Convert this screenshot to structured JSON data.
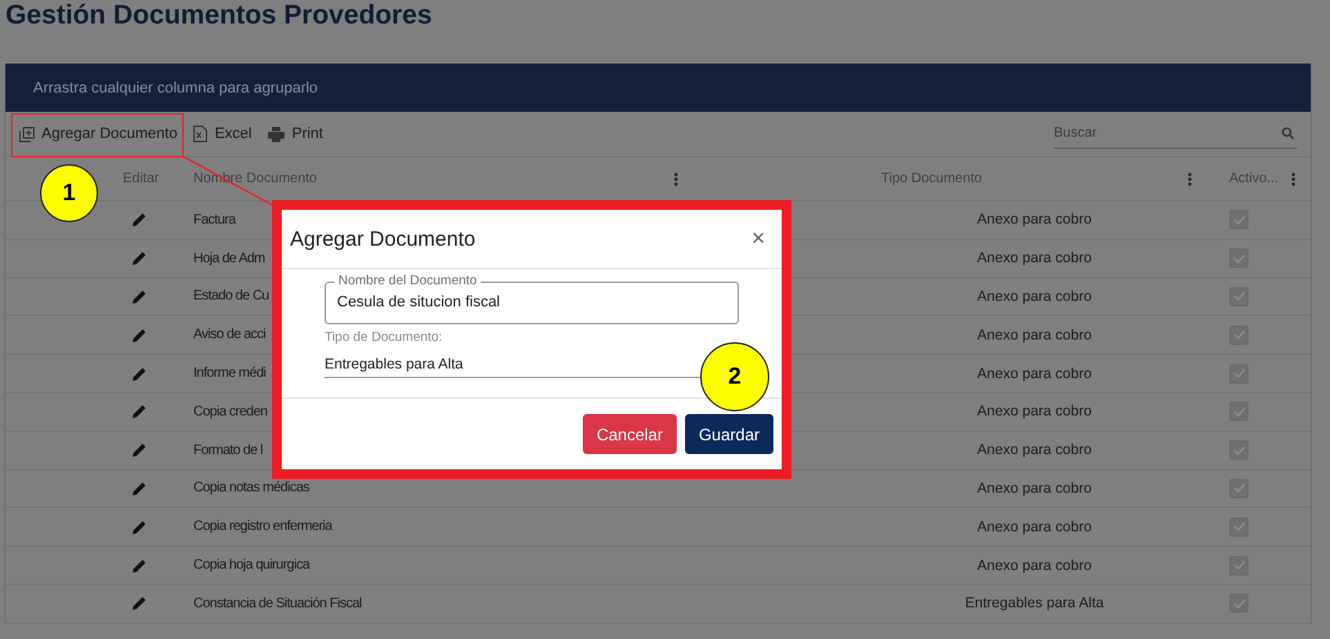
{
  "page_title": "Gestión Documentos Provedores",
  "group_bar": {
    "text": "Arrastra cualquier columna para agruparlo"
  },
  "toolbar": [
    {
      "kind": "add",
      "label": "Agregar Documento"
    },
    {
      "kind": "excel",
      "label": "Excel"
    },
    {
      "kind": "print",
      "label": "Print"
    }
  ],
  "search": {
    "placeholder": "Buscar"
  },
  "columns": [
    "Editar",
    "Nombre Documento",
    "Tipo Documento",
    "Activo..."
  ],
  "rows": [
    {
      "name": "Factura",
      "type": "Anexo para cobro",
      "active": true
    },
    {
      "name": "Hoja de Adm",
      "type": "Anexo para cobro",
      "active": true
    },
    {
      "name": "Estado de Cu",
      "type": "Anexo para cobro",
      "active": true
    },
    {
      "name": "Aviso de acci",
      "type": "Anexo para cobro",
      "active": true
    },
    {
      "name": "Informe médi",
      "type": "Anexo para cobro",
      "active": true
    },
    {
      "name": "Copia creden",
      "type": "Anexo para cobro",
      "active": true
    },
    {
      "name": "Formato de l",
      "type": "Anexo para cobro",
      "active": true
    },
    {
      "name": "Copia notas médicas",
      "type": "Anexo para cobro",
      "active": true
    },
    {
      "name": "Copia registro enfermeria",
      "type": "Anexo para cobro",
      "active": true
    },
    {
      "name": "Copia hoja quirurgica",
      "type": "Anexo para cobro",
      "active": true
    },
    {
      "name": "Constancia de Situación Fiscal",
      "type": "Entregables para Alta",
      "active": true
    }
  ],
  "modal": {
    "title": "Agregar Documento",
    "close": "×",
    "name_field": {
      "label": "Nombre del Documento",
      "value": "Cesula de situcion fiscal"
    },
    "type_field": {
      "label": "Tipo de Documento:",
      "value": "Entregables para Alta"
    },
    "buttons": [
      {
        "kind": "cancel",
        "label": "Cancelar"
      },
      {
        "kind": "save",
        "label": "Guardar"
      }
    ]
  },
  "callouts": [
    "1",
    "2"
  ]
}
